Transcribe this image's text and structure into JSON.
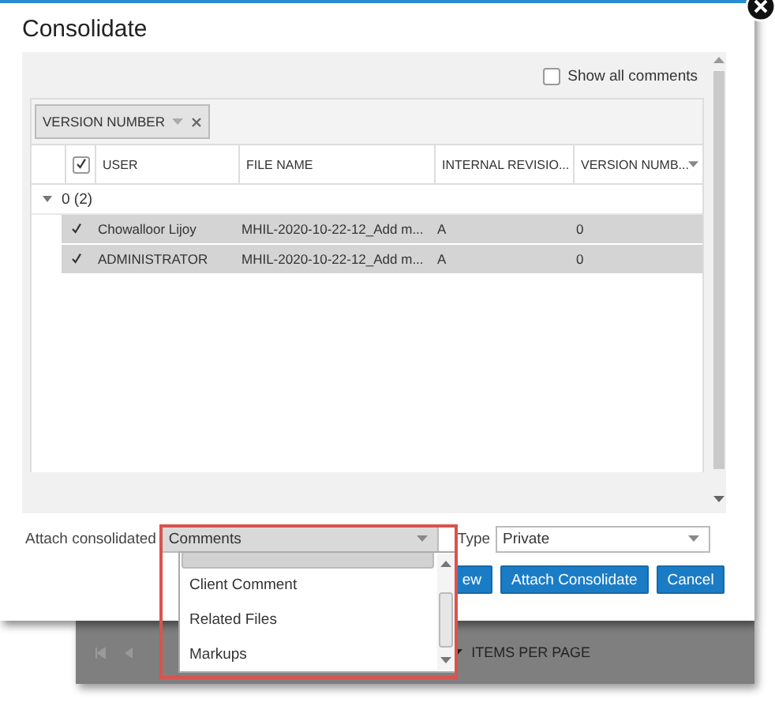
{
  "dialog": {
    "title": "Consolidate",
    "show_all_comments": {
      "label": "Show all comments",
      "checked": false
    },
    "group_panel": {
      "chip": "VERSION NUMBER"
    },
    "table": {
      "header_checked": true,
      "columns": [
        "USER",
        "FILE NAME",
        "INTERNAL REVISIO...",
        "VERSION NUMB..."
      ],
      "groups": [
        {
          "label": "0 (2)",
          "expanded": true,
          "rows": [
            {
              "checked": true,
              "selected": true,
              "cells": [
                "Chowalloor Lijoy",
                "MHIL-2020-10-22-12_Add m...",
                "A",
                "0"
              ]
            },
            {
              "checked": true,
              "selected": true,
              "cells": [
                "ADMINISTRATOR",
                "MHIL-2020-10-22-12_Add m...",
                "A",
                "0"
              ]
            }
          ]
        }
      ]
    },
    "attach_to": {
      "label": "Attach consolidated",
      "value": "Comments"
    },
    "type": {
      "label": "Type",
      "value": "Private"
    },
    "buttons": [
      "ew",
      "Attach Consolidate",
      "Cancel"
    ]
  },
  "dropdown_list": {
    "top_option_peek_selected": true,
    "options": [
      {
        "label": "Client Comment",
        "selected": false
      },
      {
        "label": "Related Files",
        "selected": false
      },
      {
        "label": "Markups",
        "selected": false
      }
    ]
  },
  "pager": {
    "items_per_page": "ITEMS PER PAGE"
  }
}
